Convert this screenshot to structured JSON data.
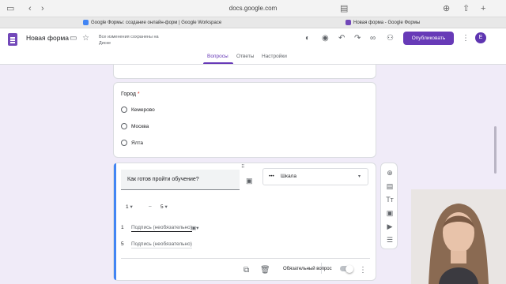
{
  "browser": {
    "url": "docs.google.com",
    "tabs": [
      {
        "title": "Google Формы: создание онлайн-форм | Google Workspace",
        "favicon_color": "#4285f4"
      },
      {
        "title": "Новая форма - Google Формы",
        "favicon_color": "#7248b9"
      }
    ]
  },
  "header": {
    "title": "Новая форма",
    "saved_status": "Все изменения сохранены на Диске",
    "publish_label": "Опубликовать",
    "avatar_letter": "E",
    "tabs": [
      {
        "label": "Вопросы",
        "active": true
      },
      {
        "label": "Ответы",
        "active": false
      },
      {
        "label": "Настройки",
        "active": false
      }
    ]
  },
  "city_question": {
    "title": "Город",
    "required_mark": "*",
    "options": [
      "Кемерово",
      "Москва",
      "Ялта"
    ]
  },
  "scale_question": {
    "title": "Как готов пройти обучение?",
    "type_label": "Шкала",
    "min": "1",
    "dash": "–",
    "max": "5",
    "min_label_index": "1",
    "min_label_placeholder": "Подпись (необязательно)",
    "max_label_index": "5",
    "max_label_placeholder": "Подпись (необязательно)",
    "required_label": "Обязательный вопрос",
    "drag_handle": "⠿"
  },
  "toolbar_icons": [
    "add-question-icon",
    "import-questions-icon",
    "add-title-icon",
    "add-image-icon",
    "add-video-icon",
    "add-section-icon"
  ],
  "colors": {
    "accent": "#673ab7",
    "active_question_bar": "#4285f4",
    "background": "#f0ebf8"
  }
}
